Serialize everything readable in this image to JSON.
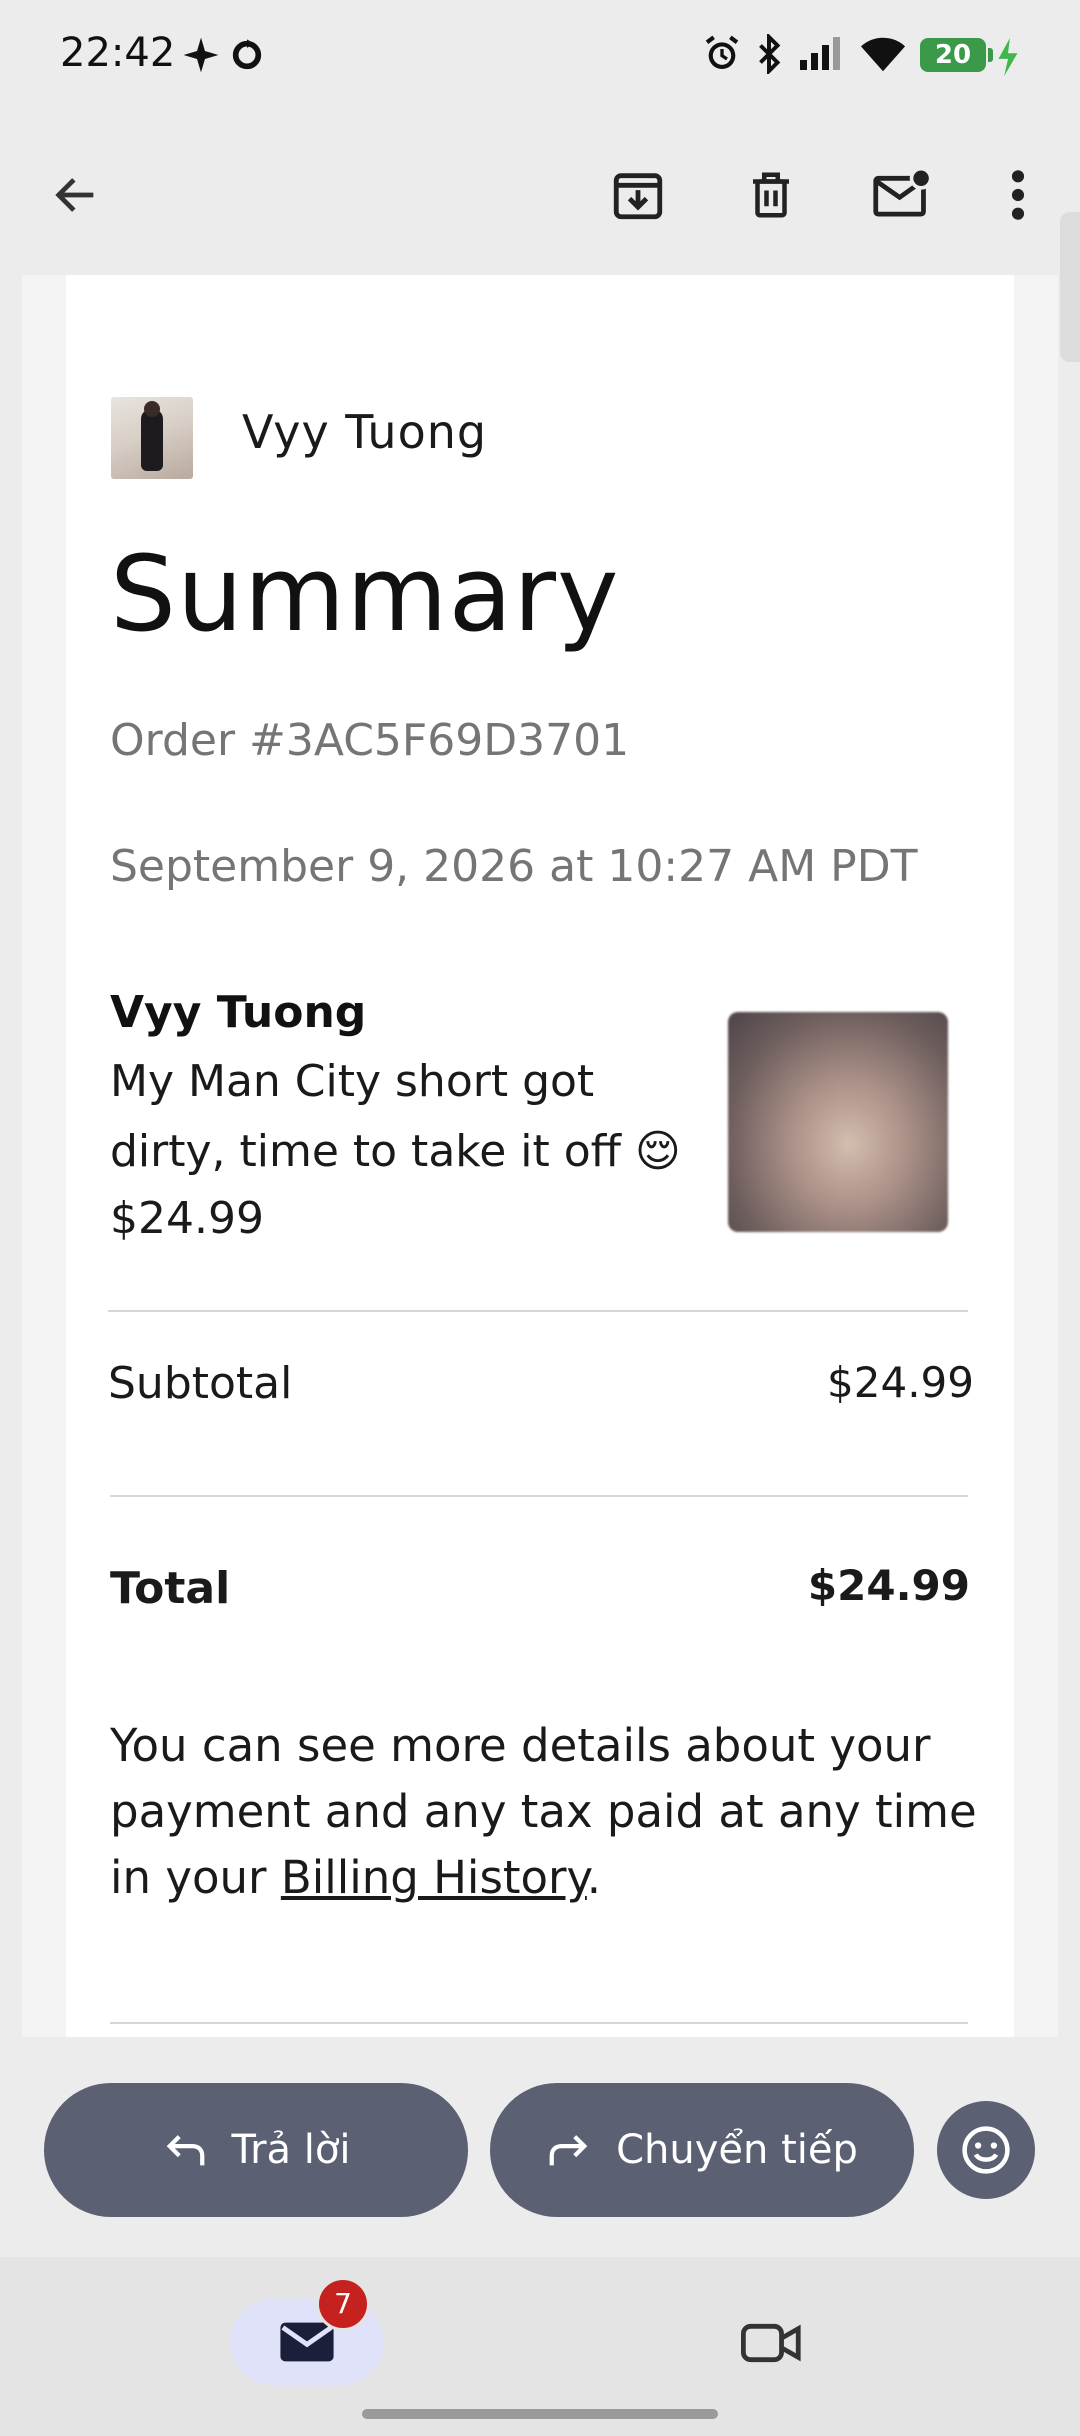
{
  "status": {
    "time": "22:42",
    "battery": "20"
  },
  "email": {
    "sender_name": "Vyy Tuong",
    "title": "Summary",
    "order_id": "Order #3AC5F69D3701",
    "date": "September 9, 2026 at 10:27 AM PDT",
    "item": {
      "creator": "Vyy Tuong",
      "description": "My Man City short got dirty, time to take it off 😌",
      "price": "$24.99"
    },
    "subtotal_label": "Subtotal",
    "subtotal_value": "$24.99",
    "total_label": "Total",
    "total_value": "$24.99",
    "note_prefix": "You can see more details about your payment and any tax paid at any time in your ",
    "note_link": "Billing History",
    "note_suffix": "."
  },
  "actions": {
    "reply_label": "Trả lời",
    "forward_label": "Chuyển tiếp"
  },
  "nav": {
    "mail_badge": "7"
  },
  "icons": {
    "back": "arrow-left-icon",
    "archive": "archive-icon",
    "delete": "trash-icon",
    "unread": "mark-unread-icon",
    "more": "more-vert-icon",
    "reply": "reply-icon",
    "forward": "forward-icon",
    "emoji": "emoji-icon",
    "mail": "mail-icon",
    "video": "video-icon"
  }
}
